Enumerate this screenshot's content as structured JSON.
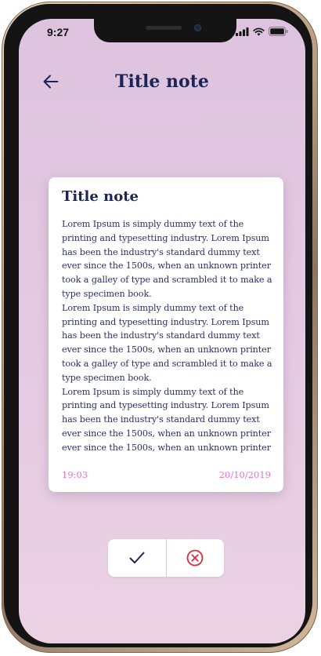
{
  "status_bar": {
    "time": "9:27",
    "icons": [
      "signal-icon",
      "wifi-icon",
      "battery-icon"
    ]
  },
  "header": {
    "back_icon": "arrow-left-icon",
    "title": "Title note"
  },
  "note": {
    "title": "Title note",
    "paragraphs": [
      "Lorem Ipsum is simply dummy text of the printing and typesetting industry. Lorem Ipsum has been the industry's standard dummy text ever since the 1500s, when an unknown printer took a galley of type and scrambled it to make a type specimen book.",
      "Lorem Ipsum is simply dummy text of the printing and typesetting industry. Lorem Ipsum has been the industry's standard dummy text ever since the 1500s, when an unknown printer took a galley of type and scrambled it to make a type specimen book.",
      "Lorem Ipsum is simply dummy text of the printing and typesetting industry. Lorem Ipsum has been the industry's standard dummy text ever since the 1500s, when an unknown printer ever since the 1500s, when an unknown printer"
    ],
    "time": "19:03",
    "date": "20/10/2019"
  },
  "actions": {
    "confirm_icon": "checkmark-icon",
    "cancel_icon": "close-circle-icon"
  },
  "colors": {
    "title_text": "#1c2455",
    "accent_pink": "#e76fd2",
    "cancel_red": "#e0283c",
    "background": "#e2c8e0"
  }
}
